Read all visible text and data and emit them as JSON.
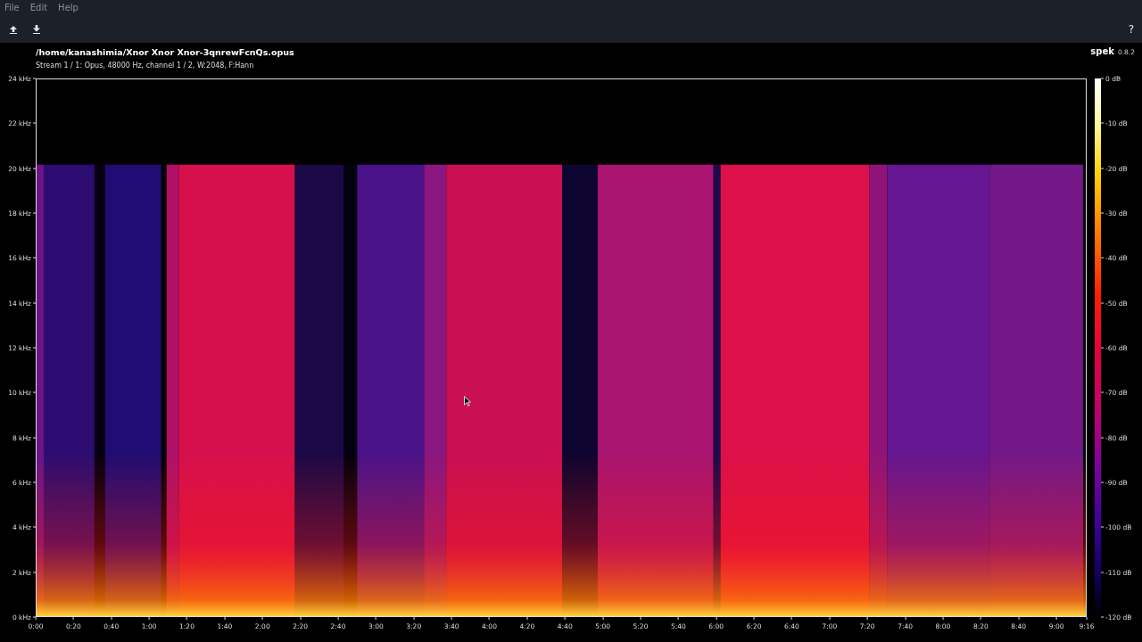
{
  "menu": [
    {
      "label": "File"
    },
    {
      "label": "Edit"
    },
    {
      "label": "Help"
    }
  ],
  "toolbar": {
    "help": "?"
  },
  "header": {
    "file": "/home/kanashimia/Xnor Xnor Xnor-3qnrewFcnQs.opus",
    "stream": "Stream 1 / 1: Opus, 48000 Hz, channel 1 / 2, W:2048, F:Hann",
    "app_name": "spek",
    "version": "0.8.2"
  },
  "frequency_axis": {
    "ticks": [
      "24 kHz",
      "22 kHz",
      "20 kHz",
      "18 kHz",
      "16 kHz",
      "14 kHz",
      "12 kHz",
      "10 kHz",
      "8 kHz",
      "6 kHz",
      "4 kHz",
      "2 kHz",
      "0 kHz"
    ]
  },
  "time_axis": {
    "ticks": [
      "0:00",
      "0:20",
      "0:40",
      "1:00",
      "1:20",
      "1:40",
      "2:00",
      "2:20",
      "2:40",
      "3:00",
      "3:20",
      "3:40",
      "4:00",
      "4:20",
      "4:40",
      "5:00",
      "5:20",
      "5:40",
      "6:00",
      "6:20",
      "6:40",
      "7:00",
      "7:20",
      "7:40",
      "8:00",
      "8:20",
      "8:40",
      "9:00",
      "9:16"
    ]
  },
  "level_scale": {
    "ticks": [
      "0 dB",
      "-10 dB",
      "-20 dB",
      "-30 dB",
      "-40 dB",
      "-50 dB",
      "-60 dB",
      "-70 dB",
      "-80 dB",
      "-90 dB",
      "-100 dB",
      "-110 dB",
      "-120 dB"
    ]
  }
}
